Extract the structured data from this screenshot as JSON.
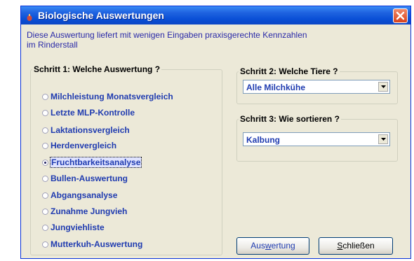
{
  "window": {
    "title": "Biologische Auswertungen",
    "close_icon": "close-icon",
    "app_icon": "app-icon"
  },
  "intro": {
    "line1": "Diese Auswertung liefert mit wenigen Eingaben praxisgerechte Kennzahlen",
    "line2": "im Rinderstall"
  },
  "step1": {
    "legend": "Schritt 1: Welche Auswertung ?",
    "options": [
      {
        "label": "Milchleistung Monatsvergleich",
        "checked": false
      },
      {
        "label": "Letzte MLP-Kontrolle",
        "checked": false
      },
      {
        "label": "Laktationsvergleich",
        "checked": false
      },
      {
        "label": "Herdenvergleich",
        "checked": false
      },
      {
        "label": "Fruchtbarkeitsanalyse",
        "checked": true
      },
      {
        "label": "Bullen-Auswertung",
        "checked": false
      },
      {
        "label": "Abgangsanalyse",
        "checked": false
      },
      {
        "label": "Zunahme Jungvieh",
        "checked": false
      },
      {
        "label": "Jungviehliste",
        "checked": false
      },
      {
        "label": "Mutterkuh-Auswertung",
        "checked": false
      }
    ]
  },
  "step2": {
    "legend": "Schritt 2:  Welche Tiere ?",
    "selected": "Alle Milchkühe"
  },
  "step3": {
    "legend": "Schritt 3: Wie sortieren ?",
    "selected": "Kalbung"
  },
  "buttons": {
    "evaluate_pre": "Aus",
    "evaluate_mnemonic": "w",
    "evaluate_post": "ertung",
    "close_mnemonic": "S",
    "close_post": "chließen"
  },
  "colors": {
    "titlebar": "#0a4fd6",
    "window_bg": "#ece9d8",
    "text_blue": "#1f3bb0"
  }
}
